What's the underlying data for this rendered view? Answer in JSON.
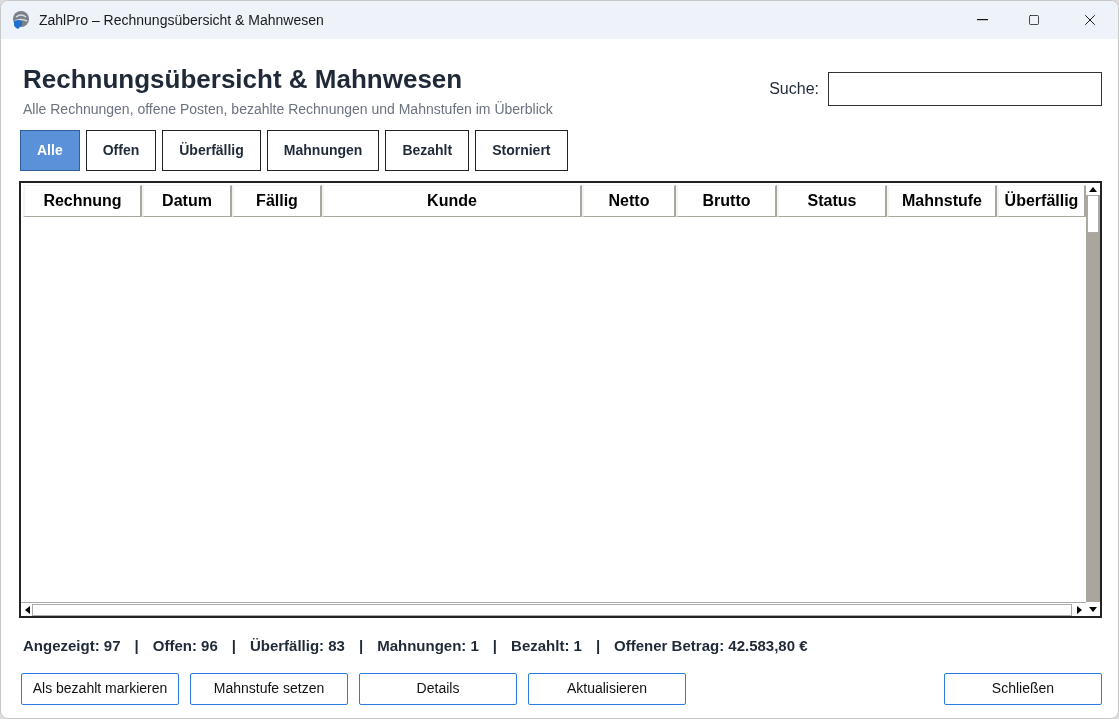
{
  "window": {
    "title": "ZahlPro – Rechnungsübersicht & Mahnwesen"
  },
  "header": {
    "title": "Rechnungsübersicht & Mahnwesen",
    "subtitle": "Alle Rechnungen, offene Posten, bezahlte Rechnungen und Mahnstufen im Überblick"
  },
  "search": {
    "label": "Suche:"
  },
  "tabs": [
    {
      "label": "Alle",
      "selected": true
    },
    {
      "label": "Offen",
      "selected": false
    },
    {
      "label": "Überfällig",
      "selected": false
    },
    {
      "label": "Mahnungen",
      "selected": false
    },
    {
      "label": "Bezahlt",
      "selected": false
    },
    {
      "label": "Storniert",
      "selected": false
    }
  ],
  "table": {
    "columns": [
      "Rechnung",
      "Datum",
      "Fällig",
      "Kunde",
      "Netto",
      "Brutto",
      "Status",
      "Mahnstufe",
      "Überfällig"
    ]
  },
  "status_bar": {
    "separator": "|",
    "items": [
      "Angezeigt: 97",
      "Offen: 96",
      "Überfällig: 83",
      "Mahnungen: 1",
      "Bezahlt: 1",
      "Offener Betrag: 42.583,80 €"
    ]
  },
  "buttons": [
    "Als bezahlt markieren",
    "Mahnstufe setzen",
    "Details",
    "Aktualisieren"
  ],
  "close_button": "Schließen"
}
